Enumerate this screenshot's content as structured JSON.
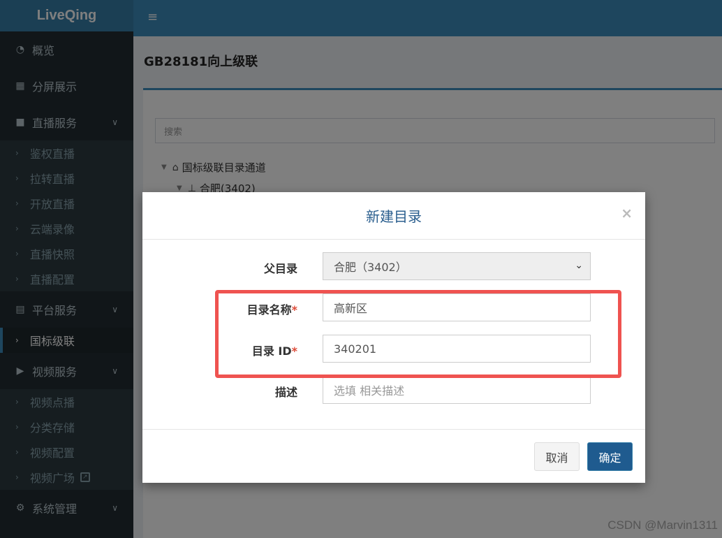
{
  "app": {
    "logo": "LiveQing"
  },
  "sidebar": {
    "items": [
      {
        "label": "概览",
        "icon": "dashboard-icon"
      },
      {
        "label": "分屏展示",
        "icon": "grid-icon"
      },
      {
        "label": "直播服务",
        "icon": "video-camera-icon",
        "children": [
          "鉴权直播",
          "拉转直播",
          "开放直播",
          "云端录像",
          "直播快照",
          "直播配置"
        ]
      },
      {
        "label": "平台服务",
        "icon": "server-icon",
        "children": [
          "国标级联"
        ],
        "active_child": "国标级联"
      },
      {
        "label": "视频服务",
        "icon": "youtube-icon",
        "children": [
          "视频点播",
          "分类存储",
          "视频配置",
          "视频广场"
        ]
      },
      {
        "label": "系统管理",
        "icon": "gear-icon"
      }
    ]
  },
  "page": {
    "title": "GB28181向上级联",
    "search_placeholder": "搜索",
    "tree": [
      {
        "label": "国标级联目录通道",
        "icon": "home-icon"
      },
      {
        "label": "合肥(3402)",
        "icon": "sitemap-icon"
      }
    ]
  },
  "modal": {
    "title": "新建目录",
    "close": "×",
    "fields": {
      "parent": {
        "label": "父目录",
        "value": "合肥（3402）"
      },
      "name": {
        "label": "目录名称",
        "required": "*",
        "value": "高新区"
      },
      "id": {
        "label": "目录 ID",
        "required": "*",
        "value": "340201"
      },
      "desc": {
        "label": "描述",
        "placeholder": "选填 相关描述"
      }
    },
    "buttons": {
      "cancel": "取消",
      "confirm": "确定"
    }
  },
  "watermark": "CSDN @Marvin1311",
  "colors": {
    "highlight": "#ef5350",
    "primary": "#1f5b8f",
    "sidebar": "#222d32",
    "topbar": "#3c8dbc"
  }
}
